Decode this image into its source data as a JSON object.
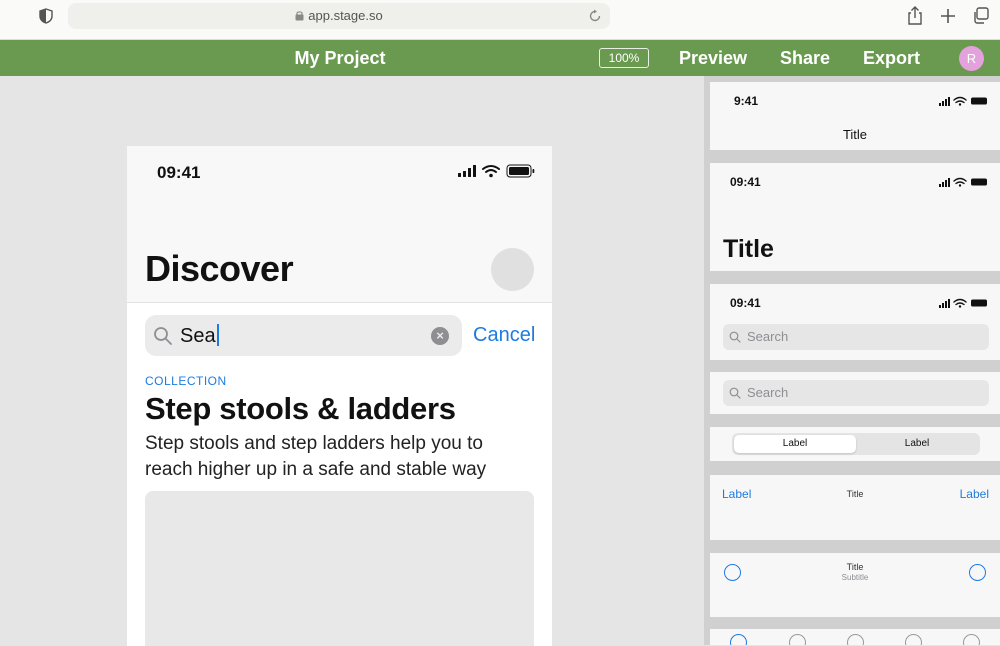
{
  "browser": {
    "url": "app.stage.so",
    "icons": [
      "shield-icon",
      "lock-icon",
      "reload-icon",
      "share-icon",
      "new-tab-icon",
      "tabs-icon"
    ]
  },
  "app_bar": {
    "title": "My Project",
    "zoom": "100%",
    "preview_label": "Preview",
    "share_label": "Share",
    "export_label": "Export",
    "avatar_initial": "R",
    "colors": {
      "bar": "#6a9a4f",
      "avatar": "#e3a2dc"
    }
  },
  "phone": {
    "time": "09:41",
    "title": "Discover",
    "search_value": "Sea",
    "cancel_label": "Cancel",
    "kicker": "COLLECTION",
    "heading": "Step stools & ladders",
    "description": "Step stools and step ladders help you to reach higher up in a safe and stable way",
    "accent": "#1e7be0"
  },
  "library": {
    "nav_card": {
      "time": "9:41",
      "title": "Title"
    },
    "large_title_card": {
      "time": "09:41",
      "title": "Title"
    },
    "search_status_card": {
      "time": "09:41",
      "placeholder": "Search"
    },
    "search_card": {
      "placeholder": "Search"
    },
    "segmented_card": {
      "segments": [
        "Label",
        "Label"
      ],
      "selected": 0
    },
    "toolbar_card": {
      "left_label": "Label",
      "title": "Title",
      "right_label": "Label"
    },
    "subtitle_card": {
      "title": "Title",
      "subtitle": "Subtitle"
    }
  }
}
